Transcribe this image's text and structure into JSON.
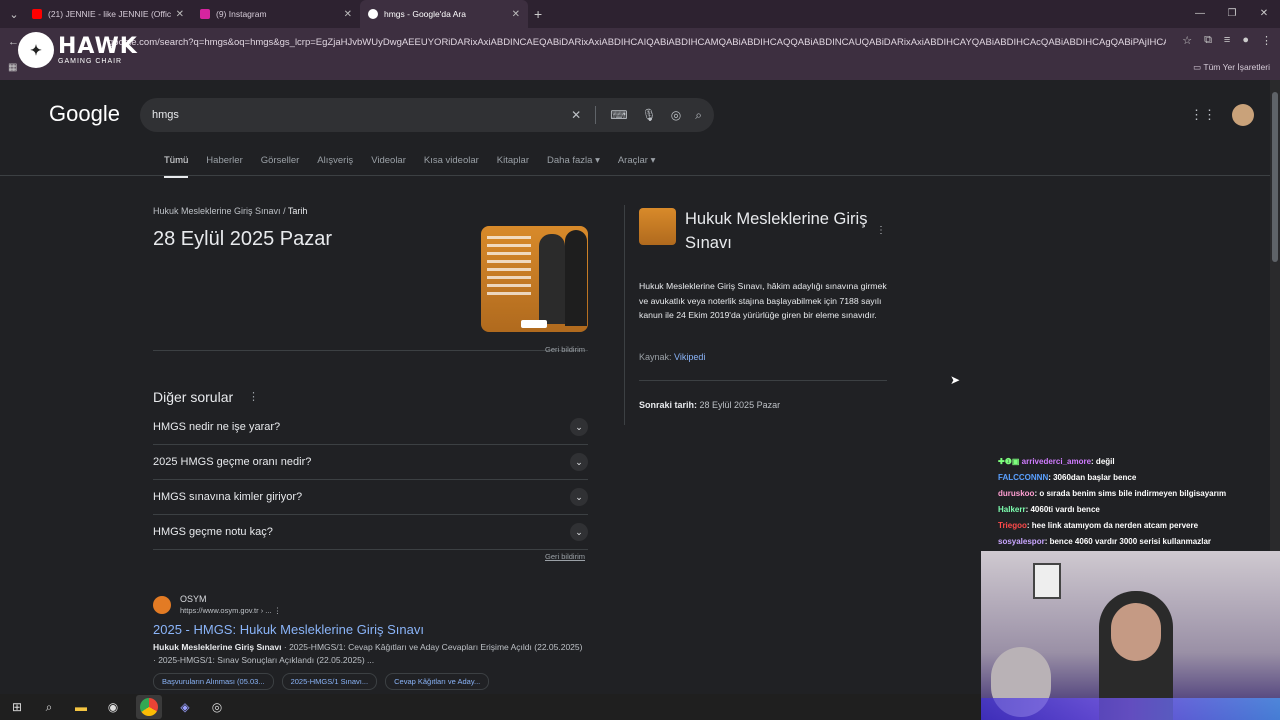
{
  "browser": {
    "tabs": [
      {
        "label": "(21) JENNIE - like JENNIE (Offic",
        "color": "#ff0000"
      },
      {
        "label": "(9) Instagram",
        "color": "#d6249f"
      },
      {
        "label": "hmgs - Google'da Ara",
        "color": "#4285f4"
      }
    ],
    "url": "google.com/search?q=hmgs&oq=hmgs&gs_lcrp=EgZjaHJvbWUyDwgAEEUYORiDARixAxiABDINCAEQABiDARixAxiABDIHCAIQABiABDIHCAMQABiABDIHCAQQABiABDINCAUQABiDARixAxiABDIHCAYQABiABDIHCAcQABiABDIHCAgQABiPAjIHCAkQABi...",
    "bookmarks_label": "Tüm Yer İşaretleri"
  },
  "overlay_logo": {
    "big": "HAWK",
    "small": "GAMING CHAIR"
  },
  "google": {
    "logo": "Google",
    "query": "hmgs",
    "tabs": [
      "Tümü",
      "Haberler",
      "Görseller",
      "Alışveriş",
      "Videolar",
      "Kısa videolar",
      "Kitaplar",
      "Daha fazla ▾",
      "Araçlar ▾"
    ]
  },
  "featured": {
    "crumb_a": "Hukuk Mesleklerine Giriş Sınavı",
    "crumb_sep": "/",
    "crumb_b": "Tarih",
    "answer": "28 Eylül 2025 Pazar",
    "feedback": "Geri bildirim"
  },
  "paa": {
    "title": "Diğer sorular",
    "items": [
      "HMGS nedir ne işe yarar?",
      "2025 HMGS geçme oranı nedir?",
      "HMGS sınavına kimler giriyor?",
      "HMGS geçme notu kaç?"
    ],
    "feedback": "Geri bildirim"
  },
  "result": {
    "site": "OSYM",
    "url": "https://www.osym.gov.tr › ...",
    "title": "2025 - HMGS: Hukuk Mesleklerine Giriş Sınavı",
    "snippet_bold": "Hukuk Mesleklerine Giriş Sınavı",
    "snippet": " · 2025-HMGS/1: Cevap Kâğıtları ve Aday Cevapları Erişime Açıldı (22.05.2025) · 2025-HMGS/1: Sınav Sonuçları Açıklandı (22.05.2025) ...",
    "chips": [
      "Başvuruların Alınması (05.03...",
      "2025-HMGS/1 Sınavı...",
      "Cevap Kâğıtları ve Aday..."
    ]
  },
  "knowledge_panel": {
    "title": "Hukuk Mesleklerine Giriş Sınavı",
    "description": "Hukuk Mesleklerine Giriş Sınavı, hâkim adaylığı sınavına girmek ve avukatlık veya noterlik stajına başlayabilmek için 7188 sayılı kanun ile 24 Ekim 2019'da yürürlüğe giren bir eleme sınavıdır.",
    "source_label": "Kaynak:",
    "source_link": "Vikipedi",
    "next_label": "Sonraki tarih:",
    "next_value": "28 Eylül 2025 Pazar"
  },
  "chat": [
    {
      "prefix": "✚❶▣ ",
      "user": "arrivederci_amore",
      "color": "#d07cff",
      "msg": ": değil"
    },
    {
      "prefix": "",
      "user": "FALCCONNN",
      "color": "#5aa0ff",
      "msg": ": 3060dan başlar bence"
    },
    {
      "prefix": "",
      "user": "duruskoo",
      "color": "#ff9fd2",
      "msg": ": o sırada benim sims bile indirmeyen bilgisayarım"
    },
    {
      "prefix": "",
      "user": "Halkerr",
      "color": "#7dffb0",
      "msg": ": 4060ti vardı bence"
    },
    {
      "prefix": "",
      "user": "Triegoo",
      "color": "#ff4a4a",
      "msg": ": hee link atamıyom da nerden atcam pervere"
    },
    {
      "prefix": "",
      "user": "sosyalespor",
      "color": "#c9a6ff",
      "msg": ": bence 4060 vardır 3000 serisi kullanmazlar"
    }
  ]
}
